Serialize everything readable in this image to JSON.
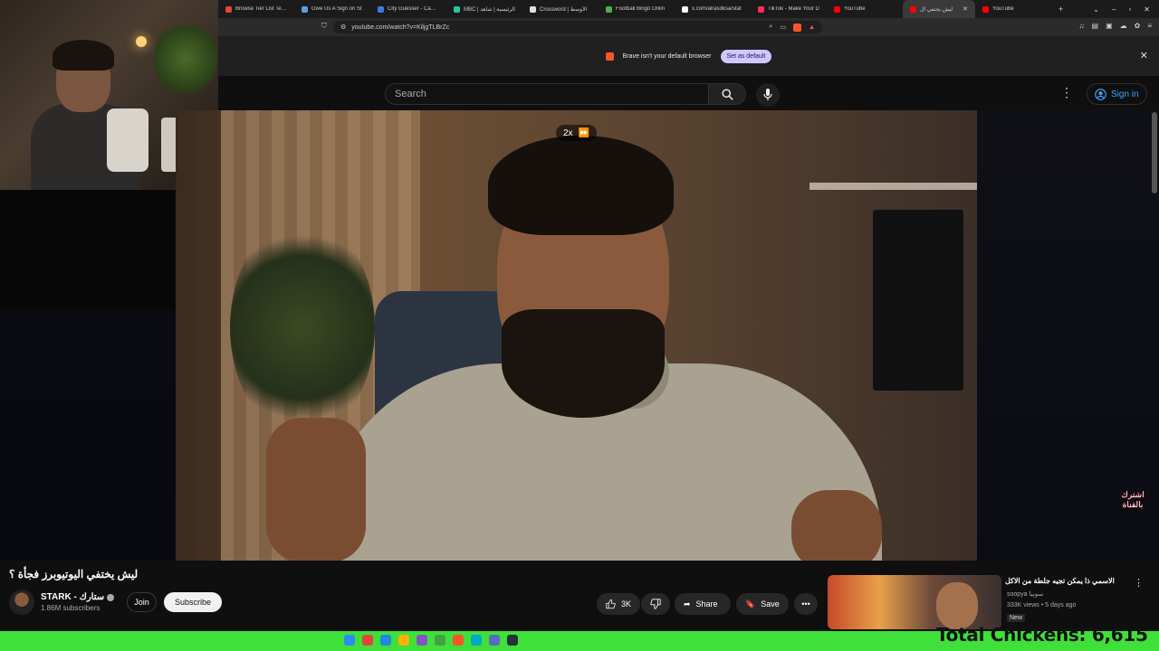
{
  "browser": {
    "tabs": [
      {
        "label": "Browse Tier List Temp",
        "color": "#e0463a"
      },
      {
        "label": "Give Us A Sign on St",
        "color": "#5aa0e0"
      },
      {
        "label": "City Guesser - Can yo",
        "color": "#3a7be0"
      },
      {
        "label": "MBC | الرئيسية | شاهد",
        "color": "#2ec4a0"
      },
      {
        "label": "Crossword | الأوسط",
        "color": "#e0e0e0"
      },
      {
        "label": "Football Bingo Onlin",
        "color": "#4caf50"
      },
      {
        "label": "x.com/alrasdksa/stat",
        "color": "#ffffff"
      },
      {
        "label": "TikTok - Make Your D",
        "color": "#ff2d55"
      },
      {
        "label": "YouTube",
        "color": "#ff0000"
      },
      {
        "label": "ليش يختفي ال",
        "color": "#ff0000",
        "active": true
      },
      {
        "label": "YouTube",
        "color": "#ff0000"
      }
    ],
    "url": "youtube.com/watch?v=KiljgTLBrZc",
    "banner_text": "Brave isn't your default browser",
    "banner_button": "Set as default"
  },
  "youtube": {
    "search_placeholder": "Search",
    "sign_in": "Sign in",
    "speed_label": "2x",
    "video_watermark": "اشترك بالقناة",
    "title": "ليش يختفي اليوتيوبرز فجأة ؟",
    "channel_name": "STARK - ستارك",
    "subscribers": "1.86M subscribers",
    "join": "Join",
    "subscribe": "Subscribe",
    "likes": "3K",
    "share": "Share",
    "save": "Save",
    "recommendation": {
      "title": "الاسمي ذا يمكن تجيه جلطة من الاكل",
      "channel": "soopya سوبيا",
      "meta": "333K views • 5 days ago",
      "badge": "New"
    }
  },
  "overlay": {
    "chickens_text": "Total Chickens: 6,615"
  },
  "colors": {
    "accent_blue": "#3ea6ff",
    "overlay_green": "#3fe03a",
    "brave_orange": "#fb542b"
  }
}
